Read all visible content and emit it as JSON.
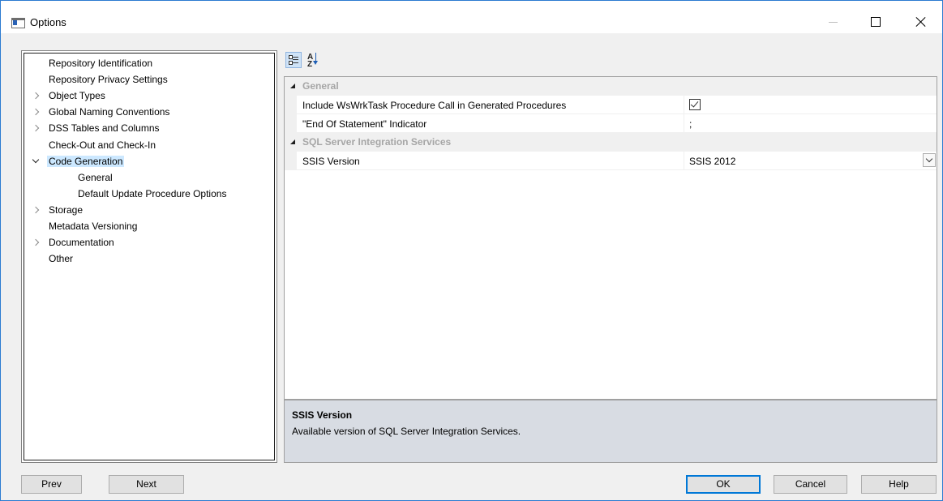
{
  "window": {
    "title": "Options"
  },
  "tree": [
    {
      "label": "Repository Identification",
      "level": 0,
      "expander": "none",
      "selected": false
    },
    {
      "label": "Repository Privacy Settings",
      "level": 0,
      "expander": "none",
      "selected": false
    },
    {
      "label": "Object Types",
      "level": 0,
      "expander": "collapsed",
      "selected": false
    },
    {
      "label": "Global Naming Conventions",
      "level": 0,
      "expander": "collapsed",
      "selected": false
    },
    {
      "label": "DSS Tables and Columns",
      "level": 0,
      "expander": "collapsed",
      "selected": false
    },
    {
      "label": "Check-Out and Check-In",
      "level": 0,
      "expander": "none",
      "selected": false
    },
    {
      "label": "Code Generation",
      "level": 0,
      "expander": "expanded",
      "selected": true
    },
    {
      "label": "General",
      "level": 1,
      "expander": "none",
      "selected": false
    },
    {
      "label": "Default Update Procedure Options",
      "level": 1,
      "expander": "none",
      "selected": false
    },
    {
      "label": "Storage",
      "level": 0,
      "expander": "collapsed",
      "selected": false
    },
    {
      "label": "Metadata Versioning",
      "level": 0,
      "expander": "none",
      "selected": false
    },
    {
      "label": "Documentation",
      "level": 0,
      "expander": "collapsed",
      "selected": false
    },
    {
      "label": "Other",
      "level": 0,
      "expander": "none",
      "selected": false
    }
  ],
  "toolbar": {
    "categorized_icon": "categorized-view-icon",
    "alphabetical_icon": "alphabetical-sort-icon"
  },
  "grid": {
    "general": {
      "category": "General",
      "include_wswrktask": {
        "name": "Include WsWrkTask Procedure Call in Generated Procedures",
        "checked": true
      },
      "end_of_statement": {
        "name": "\"End Of Statement\" Indicator",
        "value": ";"
      }
    },
    "ssis": {
      "category": "SQL Server Integration Services",
      "ssis_version": {
        "name": "SSIS Version",
        "value": "SSIS 2012"
      }
    }
  },
  "description": {
    "title": "SSIS Version",
    "text": "Available version of SQL Server Integration Services."
  },
  "buttons": {
    "prev": "Prev",
    "next": "Next",
    "ok": "OK",
    "cancel": "Cancel",
    "help": "Help"
  },
  "colors": {
    "window_border": "#2b7bd1",
    "selection": "#cce8ff",
    "category_text": "#a6a6a6",
    "description_bg": "#d8dce3",
    "default_button_border": "#0078d7"
  }
}
